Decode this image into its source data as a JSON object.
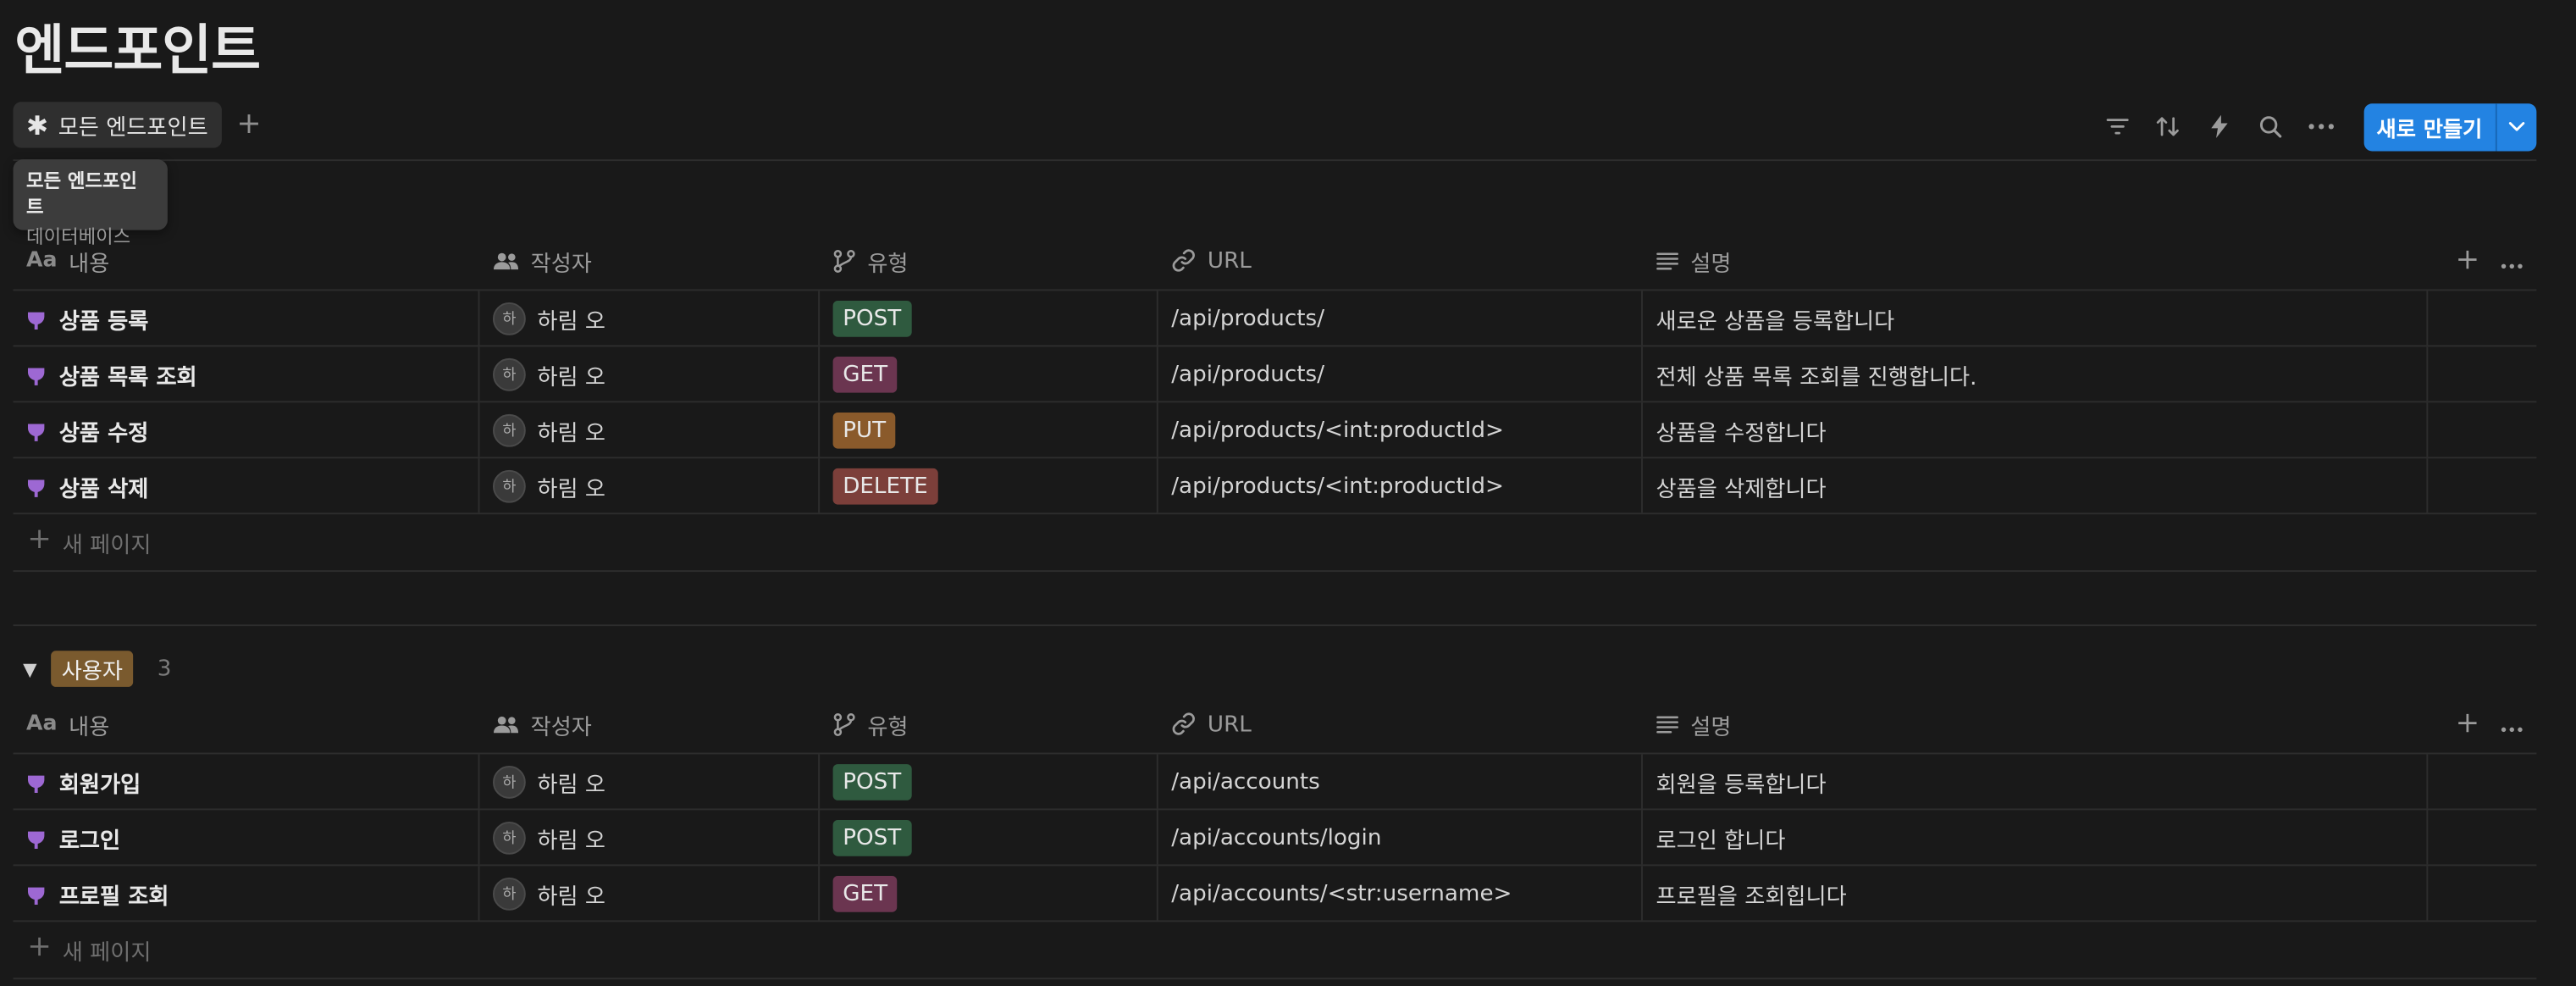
{
  "page": {
    "title": "엔드포인트"
  },
  "colors": {
    "accent": "#2383e2",
    "plug_icon": "#9d68d3",
    "tag_POST": "#2f5a3f",
    "tag_GET": "#6b3550",
    "tag_PUT": "#8a5a2b",
    "tag_DELETE": "#7c3f3a",
    "group_tag": "#7a5a2e"
  },
  "view": {
    "tab_label": "모든 엔드포인트",
    "tab_icon": "asterisk-icon",
    "add_view_icon": "plus-icon",
    "tooltip_title": "모든 엔드포인트",
    "tooltip_subtitle": "데이터베이스"
  },
  "toolbar": {
    "icons": [
      "filter-icon",
      "sort-icon",
      "automation-bolt-icon",
      "search-icon",
      "more-icon"
    ],
    "new_button_label": "새로 만들기",
    "new_dropdown_icon": "chevron-down-icon"
  },
  "columns": {
    "title": "내용",
    "title_icon_text": "Aa",
    "author": "작성자",
    "type": "유형",
    "url": "URL",
    "description": "설명"
  },
  "groups": [
    {
      "rows": [
        {
          "title": "상품 등록",
          "author": "하림 오",
          "author_initial": "하",
          "type": "POST",
          "url": "/api/products/",
          "description": "새로운 상품을 등록합니다"
        },
        {
          "title": "상품 목록 조회",
          "author": "하림 오",
          "author_initial": "하",
          "type": "GET",
          "url": "/api/products/",
          "description": "전체 상품 목록 조회를 진행합니다."
        },
        {
          "title": "상품 수정",
          "author": "하림 오",
          "author_initial": "하",
          "type": "PUT",
          "url": "/api/products/<int:productId>",
          "description": "상품을 수정합니다"
        },
        {
          "title": "상품 삭제",
          "author": "하림 오",
          "author_initial": "하",
          "type": "DELETE",
          "url": "/api/products/<int:productId>",
          "description": "상품을 삭제합니다"
        }
      ],
      "add_label": "새 페이지"
    },
    {
      "name": "사용자",
      "count": "3",
      "rows": [
        {
          "title": "회원가입",
          "author": "하림 오",
          "author_initial": "하",
          "type": "POST",
          "url": "/api/accounts",
          "description": "회원을 등록합니다"
        },
        {
          "title": "로그인",
          "author": "하림 오",
          "author_initial": "하",
          "type": "POST",
          "url": "/api/accounts/login",
          "description": "로그인 합니다"
        },
        {
          "title": "프로필 조회",
          "author": "하림 오",
          "author_initial": "하",
          "type": "GET",
          "url": "/api/accounts/<str:username>",
          "description": "프로필을 조회힙니다"
        }
      ],
      "add_label": "새 페이지"
    }
  ]
}
